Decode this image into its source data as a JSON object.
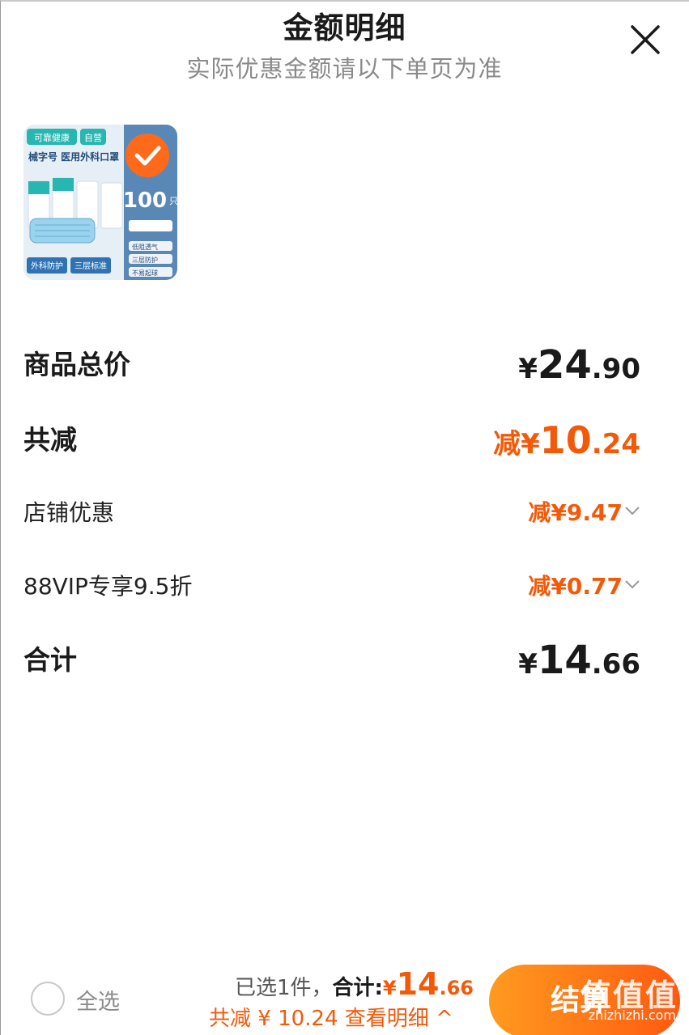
{
  "header": {
    "title": "金额明细",
    "subtitle": "实际优惠金额请以下单页为准"
  },
  "product": {
    "brand_tag": "可靠健康",
    "self_tag": "自营",
    "name": "械字号 医用外科口罩",
    "count": "100",
    "unit": "只",
    "feature_1": "外科防护",
    "feature_2": "三层标准",
    "checks": [
      "低阻透气",
      "三层防护",
      "不易起球"
    ]
  },
  "rows": {
    "total_label": "商品总价",
    "total_prefix": "¥",
    "total_int": "24",
    "total_dec": ".90",
    "reduce_label": "共减",
    "reduce_prefix": "减¥",
    "reduce_int": "10",
    "reduce_dec": ".24",
    "shop_label": "店铺优惠",
    "shop_amount": "减¥9.47",
    "vip_label": "88VIP专享9.5折",
    "vip_amount": "减¥0.77",
    "sum_label": "合计",
    "sum_prefix": "¥",
    "sum_int": "14",
    "sum_dec": ".66"
  },
  "bottom": {
    "select_all": "全选",
    "selected_text": "已选1件，",
    "sum_label": "合计:",
    "sum_prefix": "¥",
    "sum_int": "14",
    "sum_dec": ".66",
    "detail_text": "共减 ¥ 10.24 查看明细 ^",
    "checkout_label": "结算",
    "watermark_text": "值值值",
    "watermark_url": "zhizhizhi.com"
  },
  "colors": {
    "accent": "#f25a0a",
    "checkout_start": "#ff9a1f",
    "checkout_end": "#ff5a10"
  }
}
